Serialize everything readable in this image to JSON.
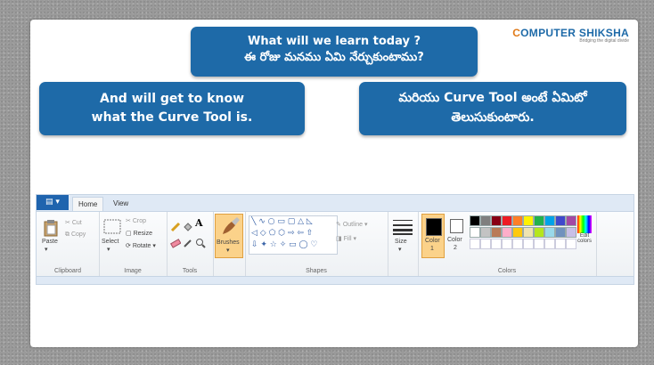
{
  "logo": {
    "brand_first": "C",
    "brand_rest": "OMPUTER SHIKSHA",
    "tagline": "Bridging the digital divide"
  },
  "title_bubble": {
    "line1": "What will we learn today ?",
    "line2": "ఈ రోజు మనము ఏమి నేర్చుకుంటాము?"
  },
  "left_bubble": {
    "line1": "And will get to know",
    "line2": "what the Curve Tool is."
  },
  "right_bubble": {
    "line1": "మరియు Curve Tool అంటే ఏమిటో",
    "line2": "తెలుసుకుంటారు."
  },
  "paint": {
    "tabs": {
      "home": "Home",
      "view": "View"
    },
    "clipboard": {
      "paste": "Paste",
      "cut": "Cut",
      "copy": "Copy",
      "label": "Clipboard"
    },
    "image": {
      "select": "Select",
      "crop": "Crop",
      "resize": "Resize",
      "rotate": "Rotate",
      "label": "Image"
    },
    "tools": {
      "label": "Tools"
    },
    "brushes": {
      "label": "Brushes"
    },
    "shapes": {
      "outline": "Outline",
      "fill": "Fill",
      "label": "Shapes"
    },
    "size": {
      "label": "Size"
    },
    "color1": {
      "label": "Color",
      "num": "1"
    },
    "color2": {
      "label": "Color",
      "num": "2"
    },
    "edit_colors": {
      "label": "Edit colors"
    },
    "colors": {
      "label": "Colors"
    },
    "palette_row1": [
      "#000000",
      "#7f7f7f",
      "#880015",
      "#ed1c24",
      "#ff7f27",
      "#fff200",
      "#22b14c",
      "#00a2e8",
      "#3f48cc",
      "#a349a4"
    ],
    "palette_row2": [
      "#ffffff",
      "#c3c3c3",
      "#b97a57",
      "#ffaec9",
      "#ffc90e",
      "#efe4b0",
      "#b5e61d",
      "#99d9ea",
      "#7092be",
      "#c8bfe7"
    ],
    "active_color": "#000000",
    "brand_color": "#1e6aa8"
  }
}
